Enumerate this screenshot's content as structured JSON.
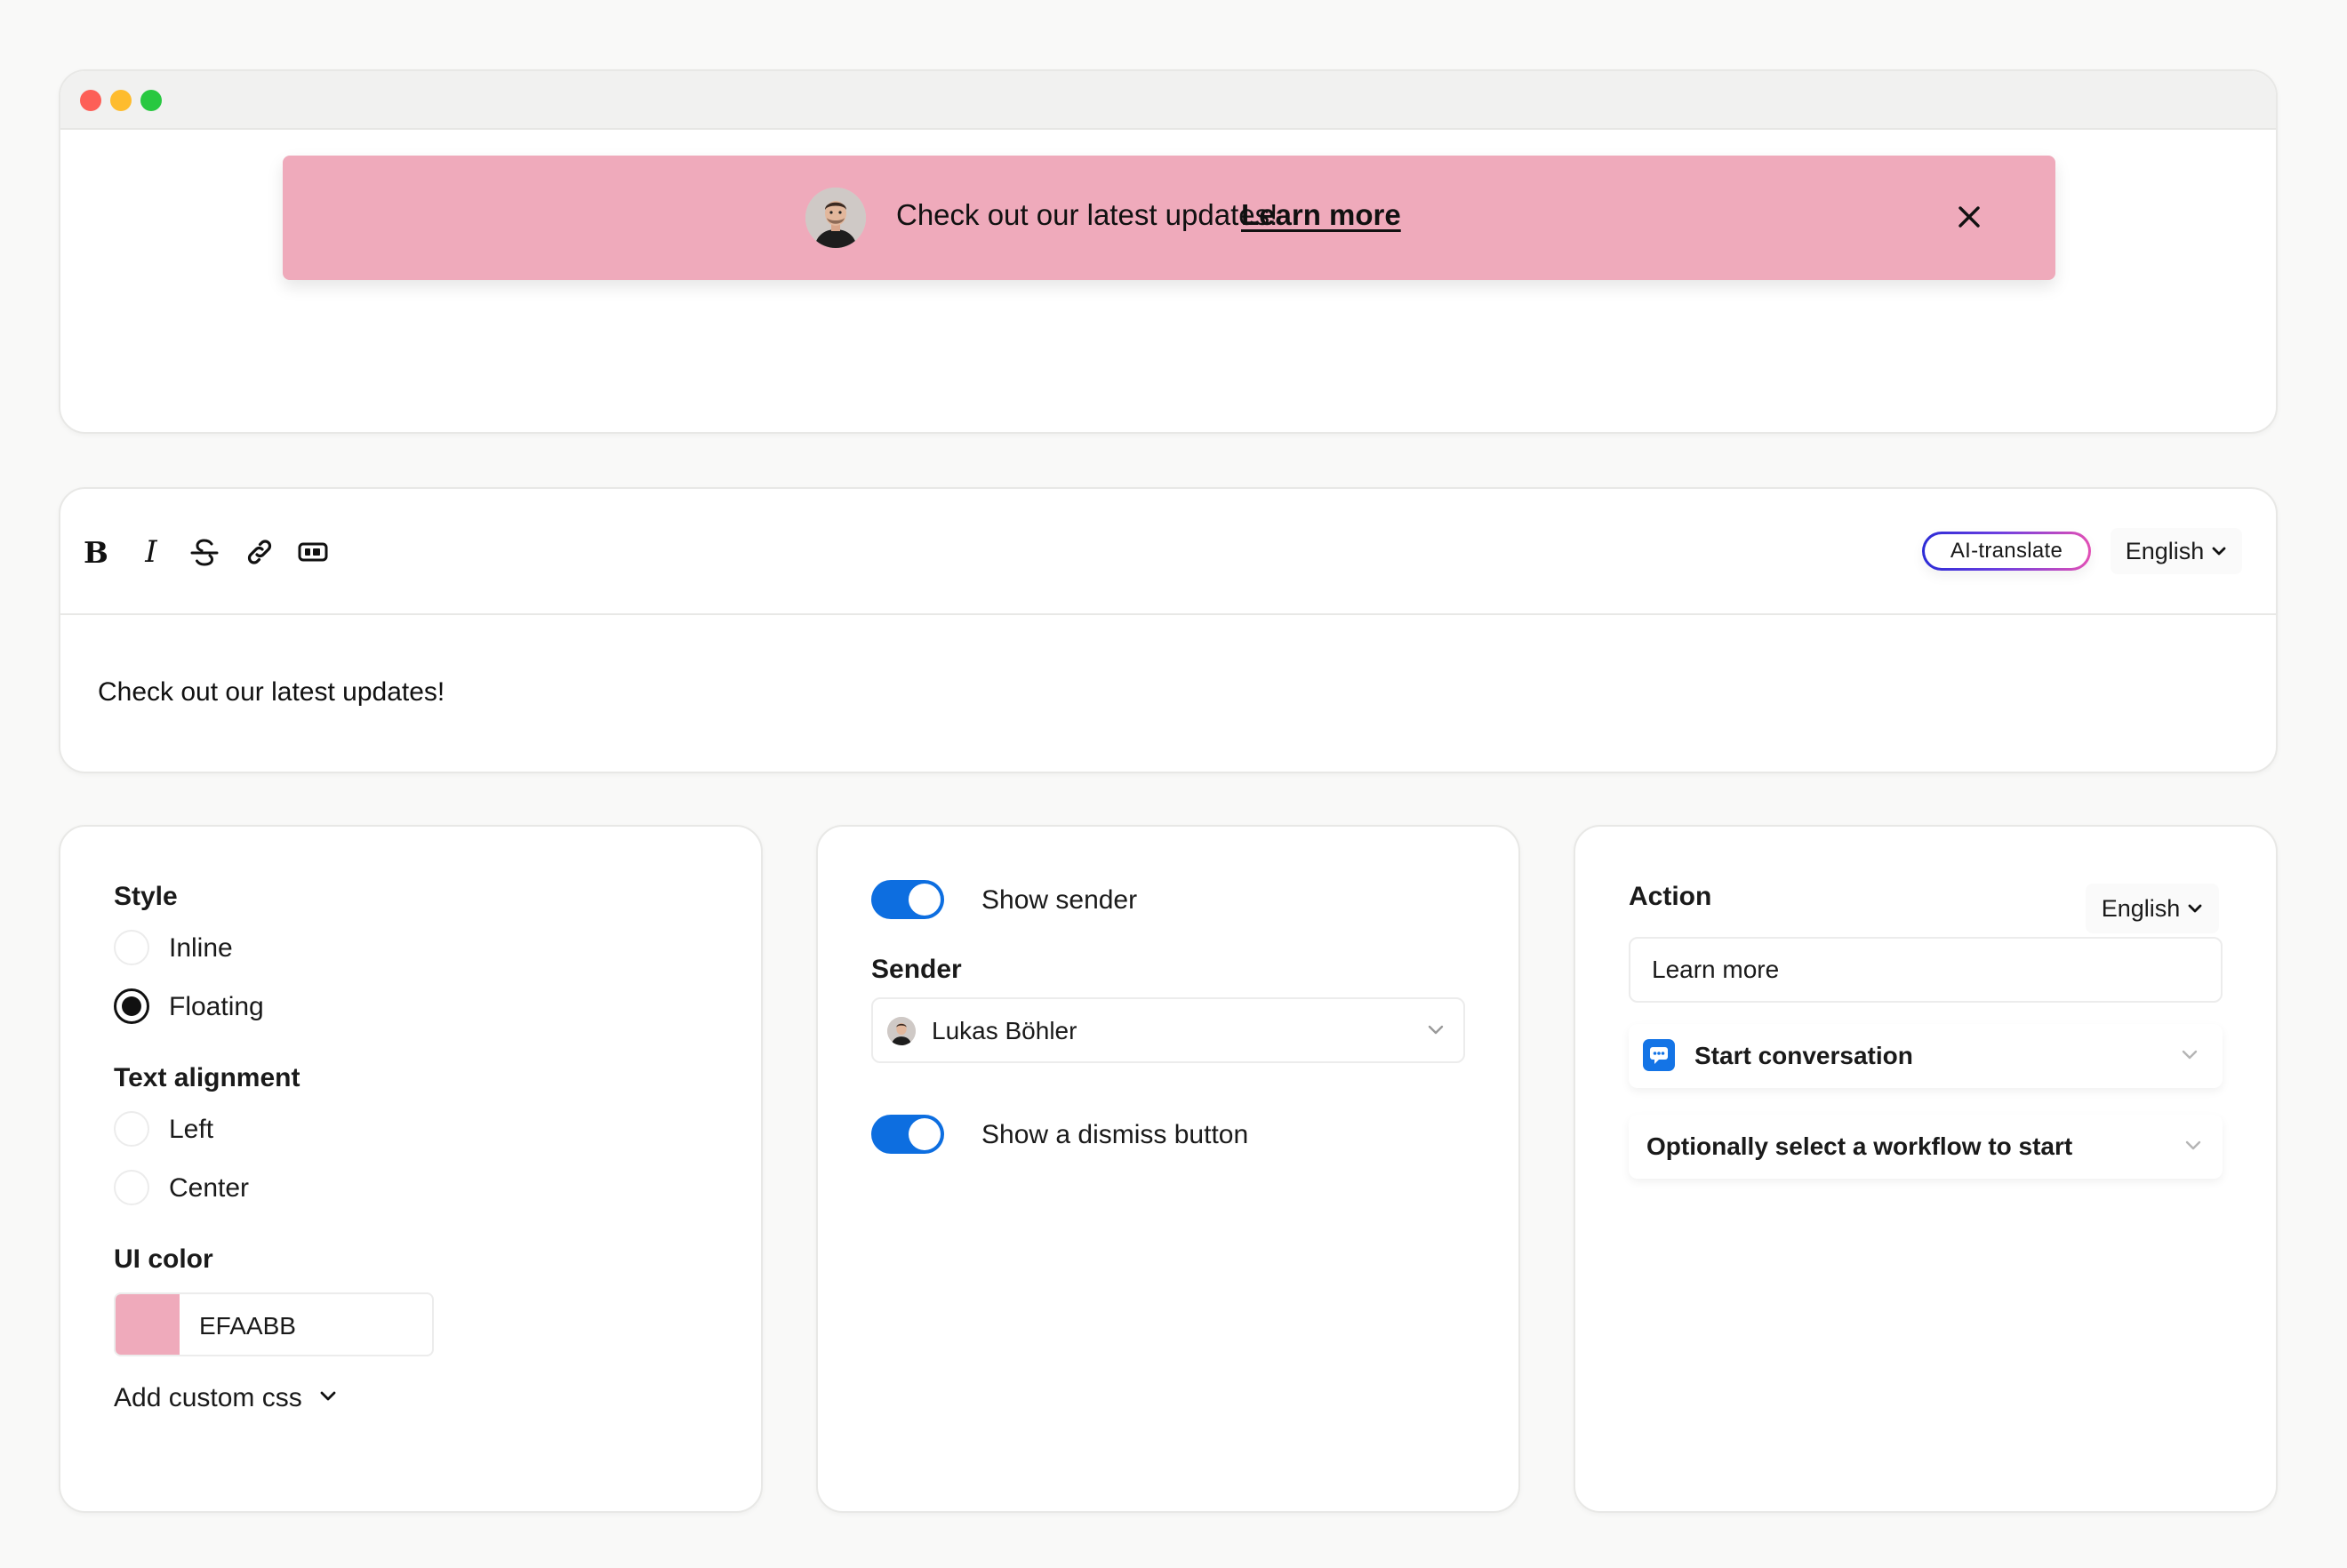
{
  "preview": {
    "banner_text": "Check out our latest updates!",
    "banner_link": "Learn more",
    "banner_color": "#EFAABB",
    "close_icon": "close-icon"
  },
  "editor": {
    "tools": [
      "bold-icon",
      "italic-icon",
      "strikethrough-icon",
      "link-icon",
      "embed-icon"
    ],
    "bold_glyph": "B",
    "italic_glyph": "I",
    "ai_translate_label": "AI-translate",
    "language": "English",
    "body_text": "Check out our latest updates!"
  },
  "style_panel": {
    "style_label": "Style",
    "style_options": [
      "Inline",
      "Floating"
    ],
    "style_selected": "Floating",
    "alignment_label": "Text alignment",
    "alignment_options": [
      "Left",
      "Center"
    ],
    "color_label": "UI color",
    "color_value": "EFAABB",
    "color_hex": "#EFAABB",
    "custom_css_label": "Add custom css"
  },
  "sender_panel": {
    "show_sender_label": "Show sender",
    "show_sender_on": true,
    "sender_label": "Sender",
    "sender_name": "Lukas Böhler",
    "dismiss_label": "Show a dismiss button",
    "dismiss_on": true,
    "toggle_color": "#0D6EE0"
  },
  "action_panel": {
    "action_label": "Action",
    "language": "English",
    "button_text_value": "Learn more",
    "action_type": "Start conversation",
    "workflow_placeholder": "Optionally select a workflow to start"
  }
}
